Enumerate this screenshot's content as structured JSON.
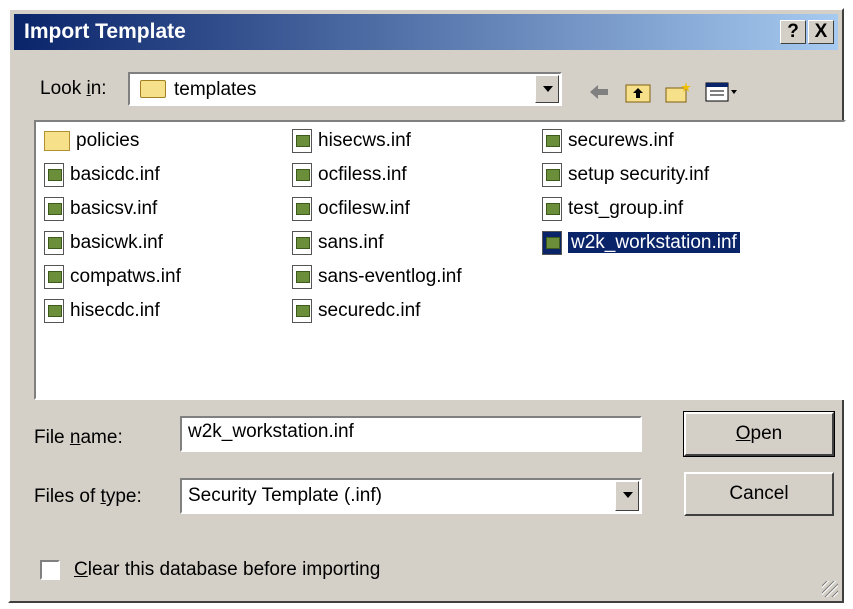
{
  "dialog": {
    "title": "Import Template",
    "help_button": "?",
    "close_button": "X"
  },
  "lookin": {
    "label_prefix": "Look ",
    "label_underlined": "i",
    "label_suffix": "n:",
    "value": "templates"
  },
  "files": [
    {
      "name": "policies",
      "type": "folder"
    },
    {
      "name": "basicdc.inf",
      "type": "file"
    },
    {
      "name": "basicsv.inf",
      "type": "file"
    },
    {
      "name": "basicwk.inf",
      "type": "file"
    },
    {
      "name": "compatws.inf",
      "type": "file"
    },
    {
      "name": "hisecdc.inf",
      "type": "file"
    },
    {
      "name": "hisecws.inf",
      "type": "file"
    },
    {
      "name": "ocfiless.inf",
      "type": "file"
    },
    {
      "name": "ocfilesw.inf",
      "type": "file"
    },
    {
      "name": "sans.inf",
      "type": "file"
    },
    {
      "name": "sans-eventlog.inf",
      "type": "file"
    },
    {
      "name": "securedc.inf",
      "type": "file"
    },
    {
      "name": "securews.inf",
      "type": "file"
    },
    {
      "name": "setup security.inf",
      "type": "file"
    },
    {
      "name": "test_group.inf",
      "type": "file"
    },
    {
      "name": "w2k_workstation.inf",
      "type": "file",
      "selected": true
    }
  ],
  "filename": {
    "label_prefix": "File ",
    "label_underlined": "n",
    "label_suffix": "ame:",
    "value": "w2k_workstation.inf"
  },
  "filetype": {
    "label_prefix": "Files of ",
    "label_underlined": "t",
    "label_suffix": "ype:",
    "value": "Security Template (.inf)"
  },
  "buttons": {
    "open_underlined": "O",
    "open_rest": "pen",
    "cancel": "Cancel"
  },
  "checkbox": {
    "label_underlined": "C",
    "label_rest": "lear this database before importing",
    "checked": false
  },
  "colors": {
    "title_start": "#0a246a",
    "title_end": "#a6caf0",
    "selection": "#0a246a",
    "face": "#d4d0c8"
  }
}
